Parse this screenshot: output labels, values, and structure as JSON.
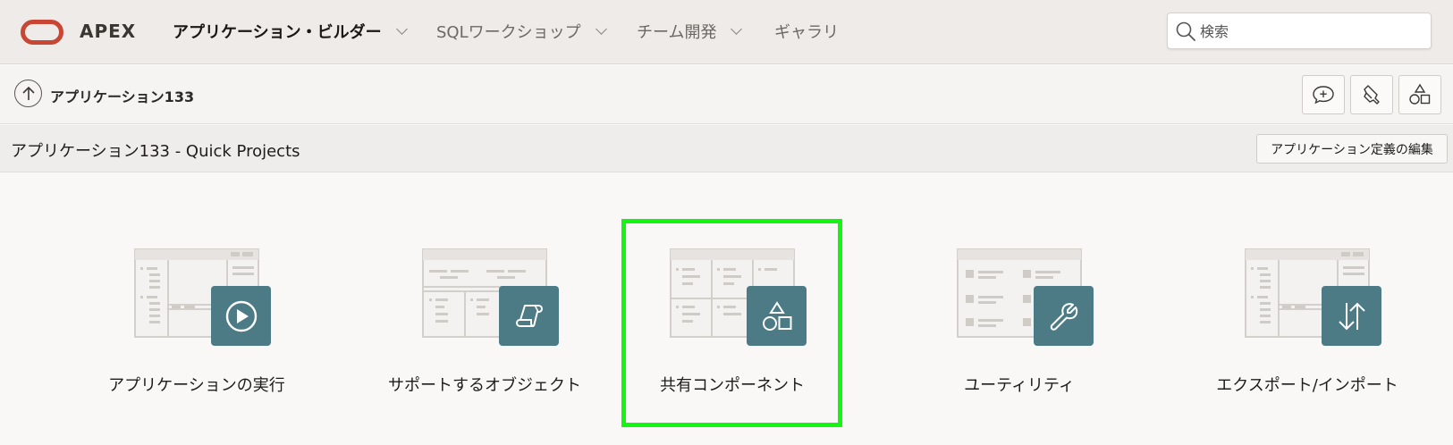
{
  "header": {
    "brand": "APEX",
    "nav": [
      {
        "label": "アプリケーション・ビルダー",
        "active": true,
        "has_menu": true
      },
      {
        "label": "SQLワークショップ",
        "active": false,
        "has_menu": true
      },
      {
        "label": "チーム開発",
        "active": false,
        "has_menu": true
      },
      {
        "label": "ギャラリ",
        "active": false,
        "has_menu": false
      }
    ],
    "search_placeholder": "検索"
  },
  "breadcrumb": {
    "label": "アプリケーション133",
    "tools": [
      "feedback-icon",
      "debug-icon",
      "shared-components-icon"
    ]
  },
  "region": {
    "title": "アプリケーション133 - Quick Projects",
    "edit_button": "アプリケーション定義の編集"
  },
  "tiles": [
    {
      "label": "アプリケーションの実行",
      "icon": "play-icon"
    },
    {
      "label": "サポートするオブジェクト",
      "icon": "scroll-icon"
    },
    {
      "label": "共有コンポーネント",
      "icon": "shapes-icon",
      "highlighted": true
    },
    {
      "label": "ユーティリティ",
      "icon": "wrench-icon"
    },
    {
      "label": "エクスポート/インポート",
      "icon": "transfer-icon"
    }
  ],
  "colors": {
    "accent": "#4c7b86",
    "oracle_red": "#c74634",
    "highlight": "#15f514"
  }
}
